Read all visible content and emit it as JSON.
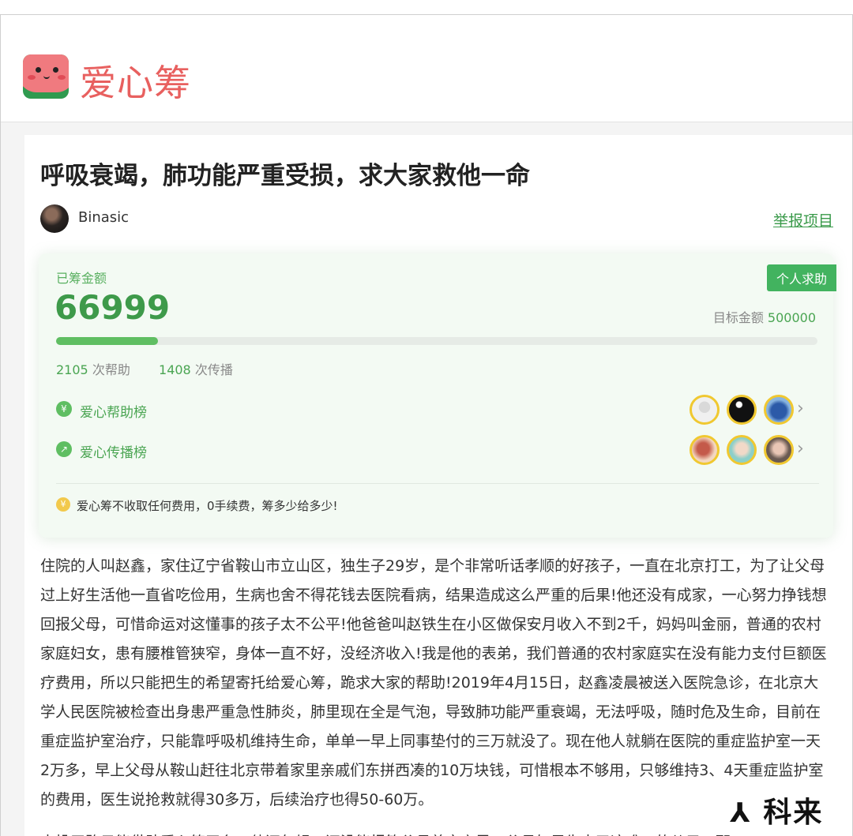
{
  "header": {
    "logo_text": "爱心筹"
  },
  "project": {
    "title": "呼吸衰竭，肺功能严重受损，求大家救他一命",
    "author": "Binasic",
    "report_link": "举报项目"
  },
  "fundraise": {
    "tag": "个人求助",
    "raised_label": "已筹金额",
    "raised_amount": "66999",
    "target_label": "目标金额",
    "target_amount": "500000",
    "progress_fraction": 0.134,
    "help_count": "2105",
    "help_label": "次帮助",
    "share_count": "1408",
    "share_label": "次传播",
    "help_rank_label": "爱心帮助榜",
    "share_rank_label": "爱心传播榜",
    "notice": "爱心筹不收取任何费用，0手续费，筹多少给多少!",
    "icon_colors": {
      "green": "#5fbe62",
      "gold": "#f0c830"
    }
  },
  "story": {
    "text": "住院的人叫赵鑫，家住辽宁省鞍山市立山区，独生子29岁，是个非常听话孝顺的好孩子，一直在北京打工，为了让父母过上好生活他一直省吃俭用，生病也舍不得花钱去医院看病，结果造成这么严重的后果!他还没有成家，一心努力挣钱想回报父母，可惜命运对这懂事的孩子太不公平!他爸爸叫赵铁生在小区做保安月收入不到2千，妈妈叫金丽，普通的农村家庭妇女，患有腰椎管狭窄，身体一直不好，没经济收入!我是他的表弟，我们普通的农村家庭实在没有能力支付巨额医疗费用，所以只能把生的希望寄托给爱心筹，跪求大家的帮助!2019年4月15日，赵鑫凌晨被送入医院急诊，在北京大学人民医院被检查出身患严重急性肺炎，肺里现在全是气泡，导致肺功能严重衰竭，无法呼吸，随时危及生命，目前在重症监护室治疗，只能靠呼吸机维持生命，单单一早上同事垫付的三万就没了。现在他人就躺在医院的重症监护室一天2万多，早上父母从鞍山赶往北京带着家里亲戚们东拼西凑的10万块钱，可惜根本不够用，只够维持3、4天重症监护室的费用，医生说抢救就得30多万，后续治疗也得50-60万。",
    "cut_line": "走投无路只能借助爱心筹平台，他还年轻，还没能报答父母养育之恩，父母如果失去了这唯一的儿子，那"
  },
  "watermark": {
    "text": "科来"
  }
}
